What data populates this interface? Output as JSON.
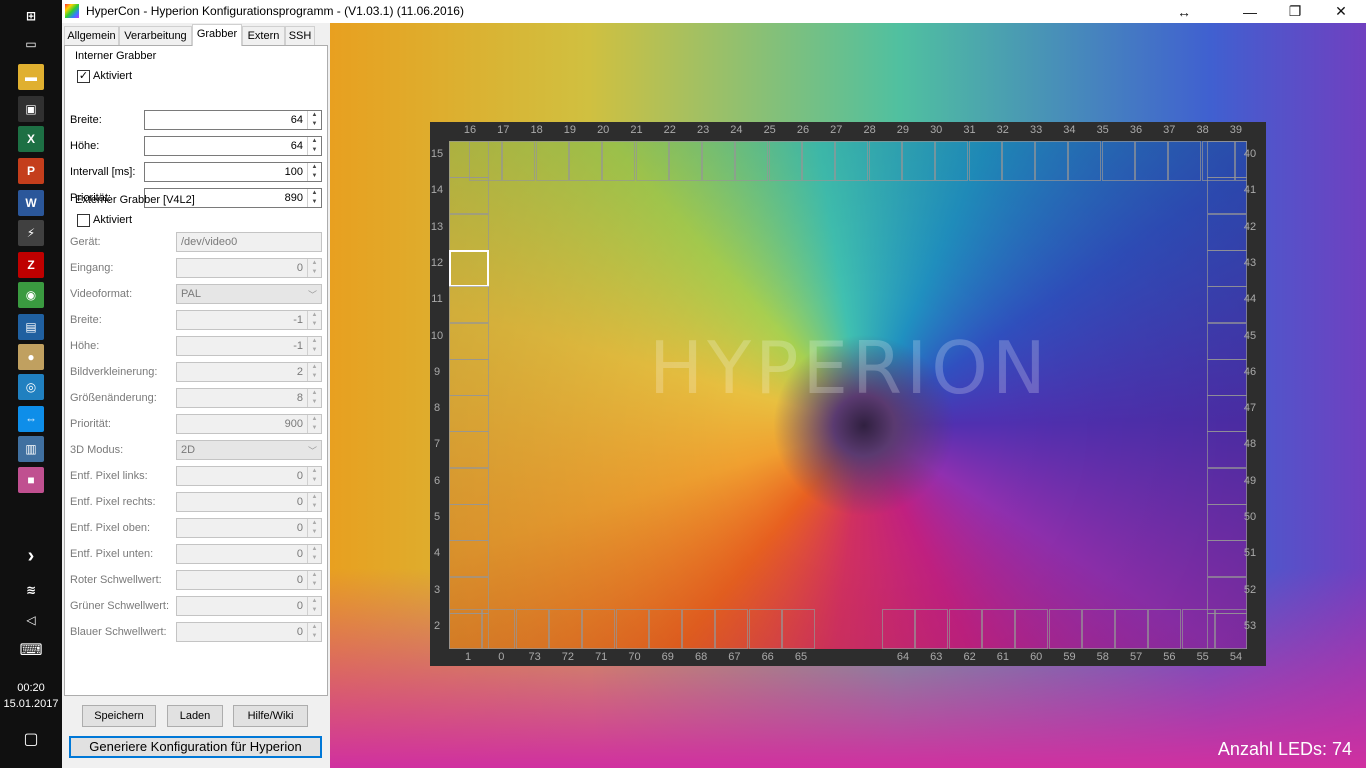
{
  "taskbar": {
    "clock_time": "00:20",
    "clock_date": "15.01.2017",
    "icons": [
      {
        "name": "windows-start-icon",
        "glyph": "⊞",
        "color": "#101010"
      },
      {
        "name": "task-view-icon",
        "glyph": "▭",
        "color": "#101010"
      },
      {
        "name": "file-explorer-icon",
        "glyph": "▬",
        "color": "#e0b030"
      },
      {
        "name": "store-icon",
        "glyph": "▣",
        "color": "#303030"
      },
      {
        "name": "excel-icon",
        "glyph": "X",
        "color": "#1d7044"
      },
      {
        "name": "powerpoint-icon",
        "glyph": "P",
        "color": "#c43e1c"
      },
      {
        "name": "word-icon",
        "glyph": "W",
        "color": "#2b579a"
      },
      {
        "name": "putty-icon",
        "glyph": "⚡",
        "color": "#404040"
      },
      {
        "name": "filezilla-icon",
        "glyph": "Z",
        "color": "#bf0000"
      },
      {
        "name": "chrome-icon",
        "glyph": "◉",
        "color": "#3a9a40"
      },
      {
        "name": "remote-desktop-icon",
        "glyph": "▤",
        "color": "#2060a0"
      },
      {
        "name": "app-icon-generic",
        "glyph": "●",
        "color": "#c0a060"
      },
      {
        "name": "app-icon-blue",
        "glyph": "◎",
        "color": "#2080c0"
      },
      {
        "name": "teamviewer-icon",
        "glyph": "⇔",
        "color": "#0e8ee9"
      },
      {
        "name": "notepad-icon",
        "glyph": "▥",
        "color": "#4070a0"
      },
      {
        "name": "hypercon-taskbar-icon",
        "glyph": "■",
        "color": "#c05090"
      }
    ],
    "tray": {
      "chevron": "›",
      "wifi": "≋",
      "volume": "◁",
      "keyboard": "⌨",
      "notification": "▢"
    }
  },
  "window": {
    "title": "HyperCon - Hyperion Konfigurationsprogramm - (V1.03.1) (11.06.2016)",
    "controls": {
      "resize": "↔",
      "minimize": "—",
      "maximize": "❐",
      "close": "✕"
    }
  },
  "tabs": [
    "Allgemein",
    "Verarbeitung",
    "Grabber",
    "Extern",
    "SSH"
  ],
  "internal_grabber": {
    "title": "Interner Grabber",
    "enabled_label": "Aktiviert",
    "enabled": true,
    "check_glyph": "✓",
    "fields": [
      {
        "label": "Breite:",
        "value": "64"
      },
      {
        "label": "Höhe:",
        "value": "64"
      },
      {
        "label": "Intervall [ms]:",
        "value": "100"
      },
      {
        "label": "Priorität:",
        "value": "890"
      }
    ]
  },
  "external_grabber": {
    "title": "Externer Grabber [V4L2]",
    "enabled_label": "Aktiviert",
    "enabled": false,
    "device_label": "Gerät:",
    "device_value": "/dev/video0",
    "input_label": "Eingang:",
    "input_value": "0",
    "videoformat_label": "Videoformat:",
    "videoformat_value": "PAL",
    "fields": [
      {
        "label": "Breite:",
        "value": "-1"
      },
      {
        "label": "Höhe:",
        "value": "-1"
      },
      {
        "label": "Bildverkleinerung:",
        "value": "2"
      },
      {
        "label": "Größenänderung:",
        "value": "8"
      },
      {
        "label": "Priorität:",
        "value": "900"
      }
    ],
    "mode3d_label": "3D Modus:",
    "mode3d_value": "2D",
    "fields2": [
      {
        "label": "Entf. Pixel links:",
        "value": "0"
      },
      {
        "label": "Entf. Pixel rechts:",
        "value": "0"
      },
      {
        "label": "Entf. Pixel oben:",
        "value": "0"
      },
      {
        "label": "Entf. Pixel unten:",
        "value": "0"
      },
      {
        "label": "Roter Schwellwert:",
        "value": "0"
      },
      {
        "label": "Grüner Schwellwert:",
        "value": "0"
      },
      {
        "label": "Blauer Schwellwert:",
        "value": "0"
      }
    ]
  },
  "buttons": {
    "save": "Speichern",
    "load": "Laden",
    "help": "Hilfe/Wiki",
    "generate": "Generiere Konfiguration für Hyperion"
  },
  "preview": {
    "watermark": "HYPERION",
    "led_count_label": "Anzahl LEDs: 74",
    "top_numbers": [
      "16",
      "17",
      "18",
      "19",
      "20",
      "21",
      "22",
      "23",
      "24",
      "25",
      "26",
      "27",
      "28",
      "29",
      "30",
      "31",
      "32",
      "33",
      "34",
      "35",
      "36",
      "37",
      "38",
      "39"
    ],
    "right_numbers": [
      "40",
      "41",
      "42",
      "43",
      "44",
      "45",
      "46",
      "47",
      "48",
      "49",
      "50",
      "51",
      "52",
      "53"
    ],
    "bottom_left_numbers": [
      "1",
      "0",
      "73",
      "72",
      "71",
      "70",
      "69",
      "68",
      "67",
      "66",
      "65"
    ],
    "bottom_right_numbers": [
      "64",
      "63",
      "62",
      "61",
      "60",
      "59",
      "58",
      "57",
      "56",
      "55",
      "54"
    ],
    "left_numbers": [
      "15",
      "14",
      "13",
      "12",
      "11",
      "10",
      "9",
      "8",
      "7",
      "6",
      "5",
      "4",
      "3",
      "2"
    ],
    "highlighted_led": "12"
  }
}
